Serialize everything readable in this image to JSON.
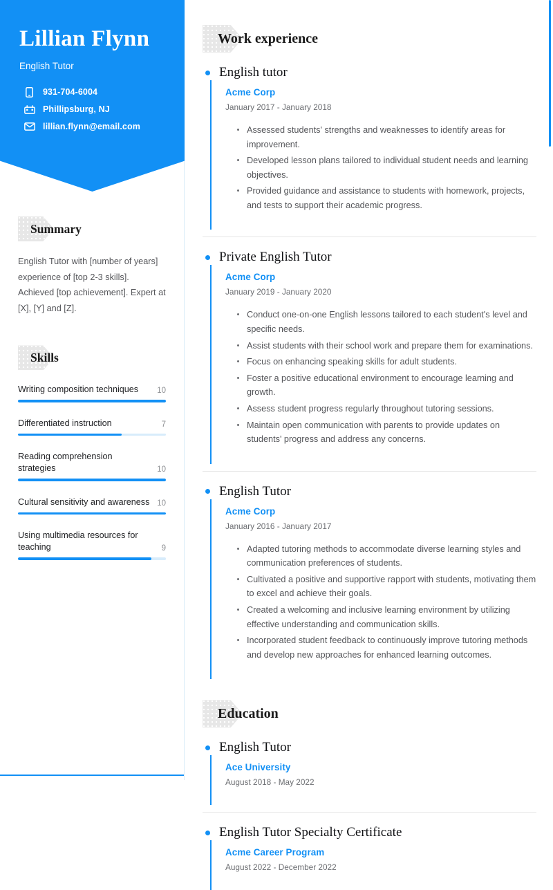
{
  "header": {
    "name": "Lillian Flynn",
    "title": "English Tutor",
    "contacts": [
      {
        "icon": "phone-icon",
        "value": "931-704-6004"
      },
      {
        "icon": "location-icon",
        "value": "Phillipsburg, NJ"
      },
      {
        "icon": "email-icon",
        "value": "lillian.flynn@email.com"
      }
    ]
  },
  "colors": {
    "accent": "#1290f5",
    "tag_bg": "#e7e7e7",
    "body_text": "#55565a",
    "heading_text": "#111215"
  },
  "sidebar": {
    "summary": {
      "heading": "Summary",
      "text": "English Tutor with [number of years] experience of [top 2-3 skills]. Achieved [top achievement]. Expert at [X], [Y] and [Z]."
    },
    "skills": {
      "heading": "Skills",
      "max": 10,
      "items": [
        {
          "name": "Writing composition techniques",
          "value": 10
        },
        {
          "name": "Differentiated instruction",
          "value": 7
        },
        {
          "name": "Reading comprehension strategies",
          "value": 10
        },
        {
          "name": "Cultural sensitivity and awareness",
          "value": 10
        },
        {
          "name": "Using multimedia resources for teaching",
          "value": 9
        }
      ]
    }
  },
  "main": {
    "work_experience": {
      "heading": "Work experience",
      "entries": [
        {
          "title": "English tutor",
          "org": "Acme Corp",
          "dates": "January 2017 - January 2018",
          "bullets": [
            "Assessed students' strengths and weaknesses to identify areas for improvement.",
            "Developed lesson plans tailored to individual student needs and learning objectives.",
            "Provided guidance and assistance to students with homework, projects, and tests to support their academic progress."
          ]
        },
        {
          "title": "Private English Tutor",
          "org": "Acme Corp",
          "dates": "January 2019 - January 2020",
          "bullets": [
            "Conduct one-on-one English lessons tailored to each student's level and specific needs.",
            "Assist students with their school work and prepare them for examinations.",
            "Focus on enhancing speaking skills for adult students.",
            "Foster a positive educational environment to encourage learning and growth.",
            "Assess student progress regularly throughout tutoring sessions.",
            "Maintain open communication with parents to provide updates on students' progress and address any concerns."
          ]
        },
        {
          "title": "English Tutor",
          "org": "Acme Corp",
          "dates": "January 2016 - January 2017",
          "bullets": [
            "Adapted tutoring methods to accommodate diverse learning styles and communication preferences of students.",
            "Cultivated a positive and supportive rapport with students, motivating them to excel and achieve their goals.",
            "Created a welcoming and inclusive learning environment by utilizing effective understanding and communication skills.",
            "Incorporated student feedback to continuously improve tutoring methods and develop new approaches for enhanced learning outcomes."
          ]
        }
      ]
    },
    "education": {
      "heading": "Education",
      "entries": [
        {
          "title": "English Tutor",
          "org": "Ace University",
          "dates": "August 2018 - May 2022"
        },
        {
          "title": "English Tutor Specialty Certificate",
          "org": "Acme Career Program",
          "dates": "August 2022 - December 2022"
        }
      ]
    }
  }
}
